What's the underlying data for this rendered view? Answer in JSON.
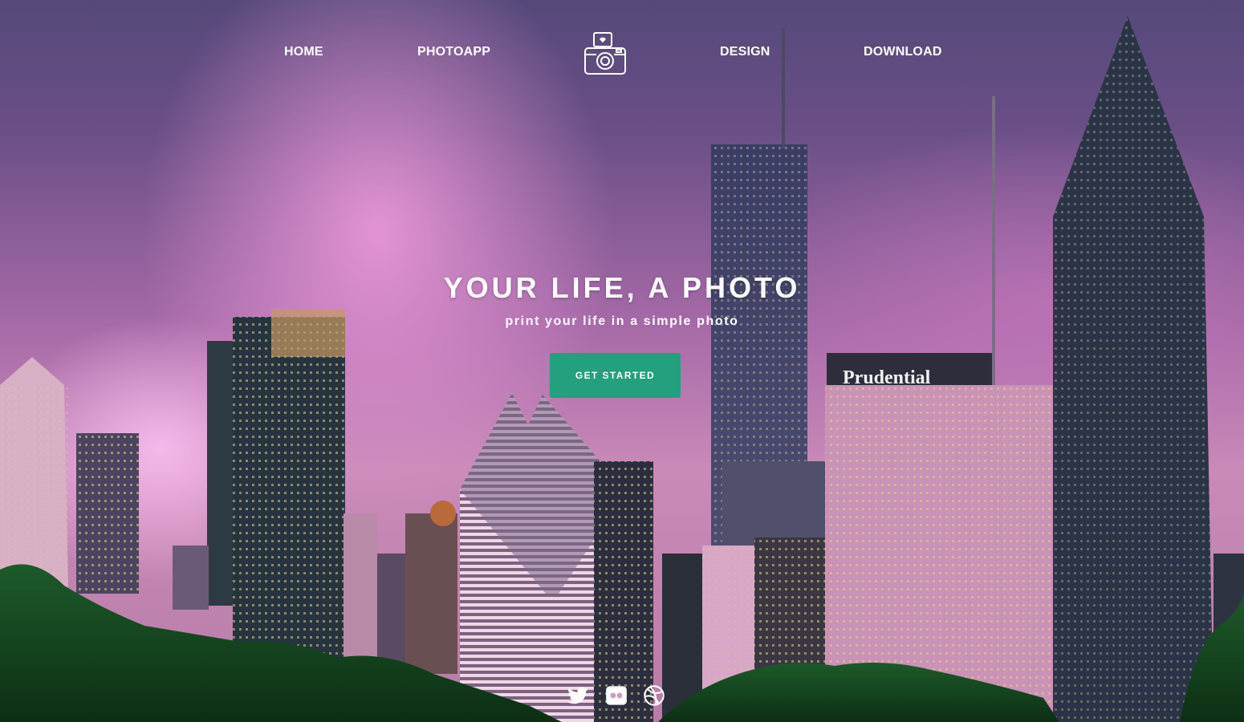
{
  "nav": {
    "items": [
      {
        "label": "HOME"
      },
      {
        "label": "PHOTOAPP"
      },
      {
        "label": "DESIGN"
      },
      {
        "label": "DOWNLOAD"
      }
    ],
    "logo_icon": "camera-icon"
  },
  "hero": {
    "title": "YOUR LIFE, A PHOTO",
    "subtitle": "print your life in a simple photo",
    "cta_label": "GET STARTED",
    "background": "city-skyline-photo",
    "building_sign": "Prudential"
  },
  "social": [
    {
      "icon": "twitter-icon"
    },
    {
      "icon": "flickr-icon"
    },
    {
      "icon": "dribbble-icon"
    }
  ],
  "colors": {
    "accent": "#23a07d",
    "text": "#ffffff"
  }
}
